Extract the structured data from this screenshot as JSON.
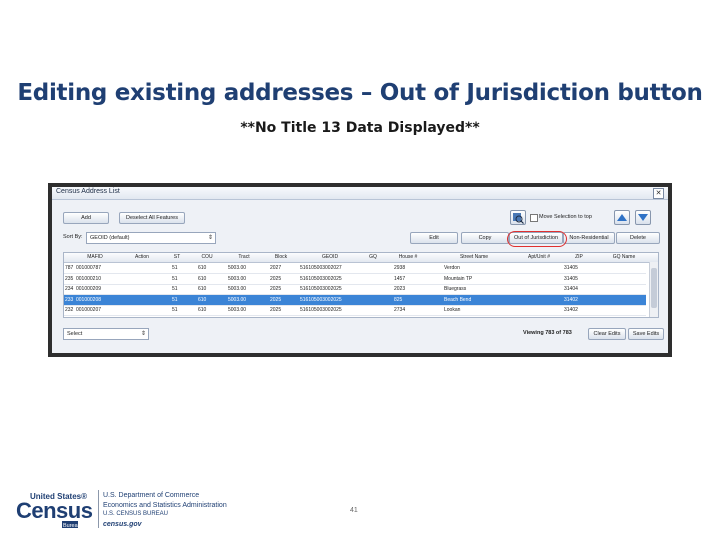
{
  "slide": {
    "title": "Editing existing addresses – Out of Jurisdiction button",
    "subtitle": "**No Title 13 Data Displayed**",
    "page_number": "41"
  },
  "window": {
    "title": "Census Address List",
    "close_glyph": "✕"
  },
  "toolbar": {
    "add_label": "Add",
    "deselect_label": "Deselect All Features",
    "move_selection_label": "Move Selection to top",
    "sort_by_label": "Sort By:",
    "sort_by_value": "GEOID (default)",
    "edit_label": "Edit",
    "copy_label": "Copy",
    "out_of_jurisdiction_label": "Out of Jurisdiction",
    "non_residential_label": "Non-Residential",
    "delete_label": "Delete"
  },
  "table": {
    "columns": [
      "MAFID",
      "Action",
      "ST",
      "COU",
      "Tract",
      "Block",
      "GEOID",
      "GQ",
      "House #",
      "Street Name",
      "Apt/Unit #",
      "ZIP",
      "GQ Name"
    ],
    "rows": [
      {
        "num": "787",
        "mafid": "001000787",
        "action": "",
        "st": "51",
        "cou": "610",
        "tract": "5003.00",
        "block": "2027",
        "geoid": "516105003002027",
        "gq": "",
        "house": "2938",
        "street": "Verdon",
        "apt": "",
        "zip": "31405",
        "gqname": "",
        "selected": false
      },
      {
        "num": "235",
        "mafid": "001000210",
        "action": "",
        "st": "51",
        "cou": "610",
        "tract": "5003.00",
        "block": "2025",
        "geoid": "516105003002025",
        "gq": "",
        "house": "1457",
        "street": "Mountain TP",
        "apt": "",
        "zip": "31405",
        "gqname": "",
        "selected": false
      },
      {
        "num": "234",
        "mafid": "001000209",
        "action": "",
        "st": "51",
        "cou": "610",
        "tract": "5003.00",
        "block": "2025",
        "geoid": "516105003002025",
        "gq": "",
        "house": "2023",
        "street": "Bluegrass",
        "apt": "",
        "zip": "31404",
        "gqname": "",
        "selected": false
      },
      {
        "num": "233",
        "mafid": "001000208",
        "action": "",
        "st": "51",
        "cou": "610",
        "tract": "5003.00",
        "block": "2025",
        "geoid": "516105003002025",
        "gq": "",
        "house": "825",
        "street": "Beach Bend",
        "apt": "",
        "zip": "31402",
        "gqname": "",
        "selected": true
      },
      {
        "num": "232",
        "mafid": "001000207",
        "action": "",
        "st": "51",
        "cou": "610",
        "tract": "5003.00",
        "block": "2025",
        "geoid": "516105003002025",
        "gq": "",
        "house": "2734",
        "street": "Lookan",
        "apt": "",
        "zip": "31402",
        "gqname": "",
        "selected": false
      }
    ]
  },
  "bottom": {
    "select_value": "Select",
    "viewing": "Viewing 783 of 783",
    "clear_edits_label": "Clear Edits",
    "save_edits_label": "Save Edits"
  },
  "footer": {
    "logo_line1": "United States®",
    "logo_word": "Census",
    "logo_bureau": "Bureau",
    "dept_line1": "U.S. Department of Commerce",
    "dept_line2": "Economics and Statistics Administration",
    "dept_line3": "U.S. CENSUS BUREAU",
    "dept_line4": "census.gov"
  },
  "colors": {
    "title": "#1f3f73",
    "selection": "#3b84d6",
    "highlight_ring": "#e0302f"
  }
}
